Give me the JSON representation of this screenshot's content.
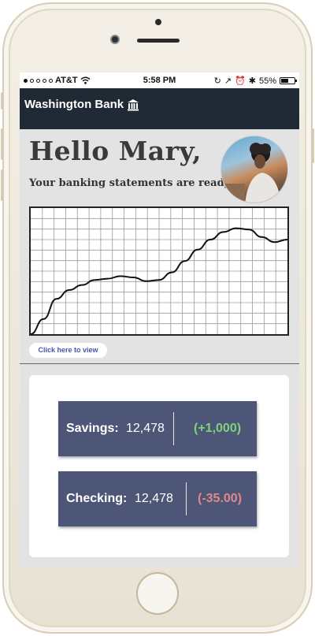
{
  "status_bar": {
    "carrier": "AT&T",
    "time": "5:58 PM",
    "battery": "55%",
    "battery_level": 0.55
  },
  "header": {
    "brand": "Washington Bank",
    "brand_icon": "bank-icon"
  },
  "hero": {
    "greeting": "Hello Mary,",
    "subtitle": "Your banking statements are ready",
    "view_button": "Click here to view"
  },
  "chart_data": {
    "type": "line",
    "x": [
      0,
      1,
      2,
      3,
      4,
      5,
      6,
      7,
      8,
      9,
      10,
      11,
      12,
      13,
      14,
      15,
      16,
      17,
      18,
      19,
      20
    ],
    "values": [
      0,
      1.2,
      2.8,
      3.5,
      3.9,
      4.3,
      4.4,
      4.6,
      4.5,
      4.2,
      4.3,
      4.9,
      5.8,
      6.7,
      7.5,
      8.1,
      8.4,
      8.3,
      7.7,
      7.3,
      7.5
    ],
    "ylim": [
      0,
      10
    ],
    "grid": true
  },
  "accounts": {
    "savings": {
      "label": "Savings:",
      "amount": "12,478",
      "change": "(+1,000)",
      "change_color": "#7ed37a"
    },
    "checking": {
      "label": "Checking:",
      "amount": "12,478",
      "change": "(-35.00)",
      "change_color": "#e08787"
    }
  }
}
